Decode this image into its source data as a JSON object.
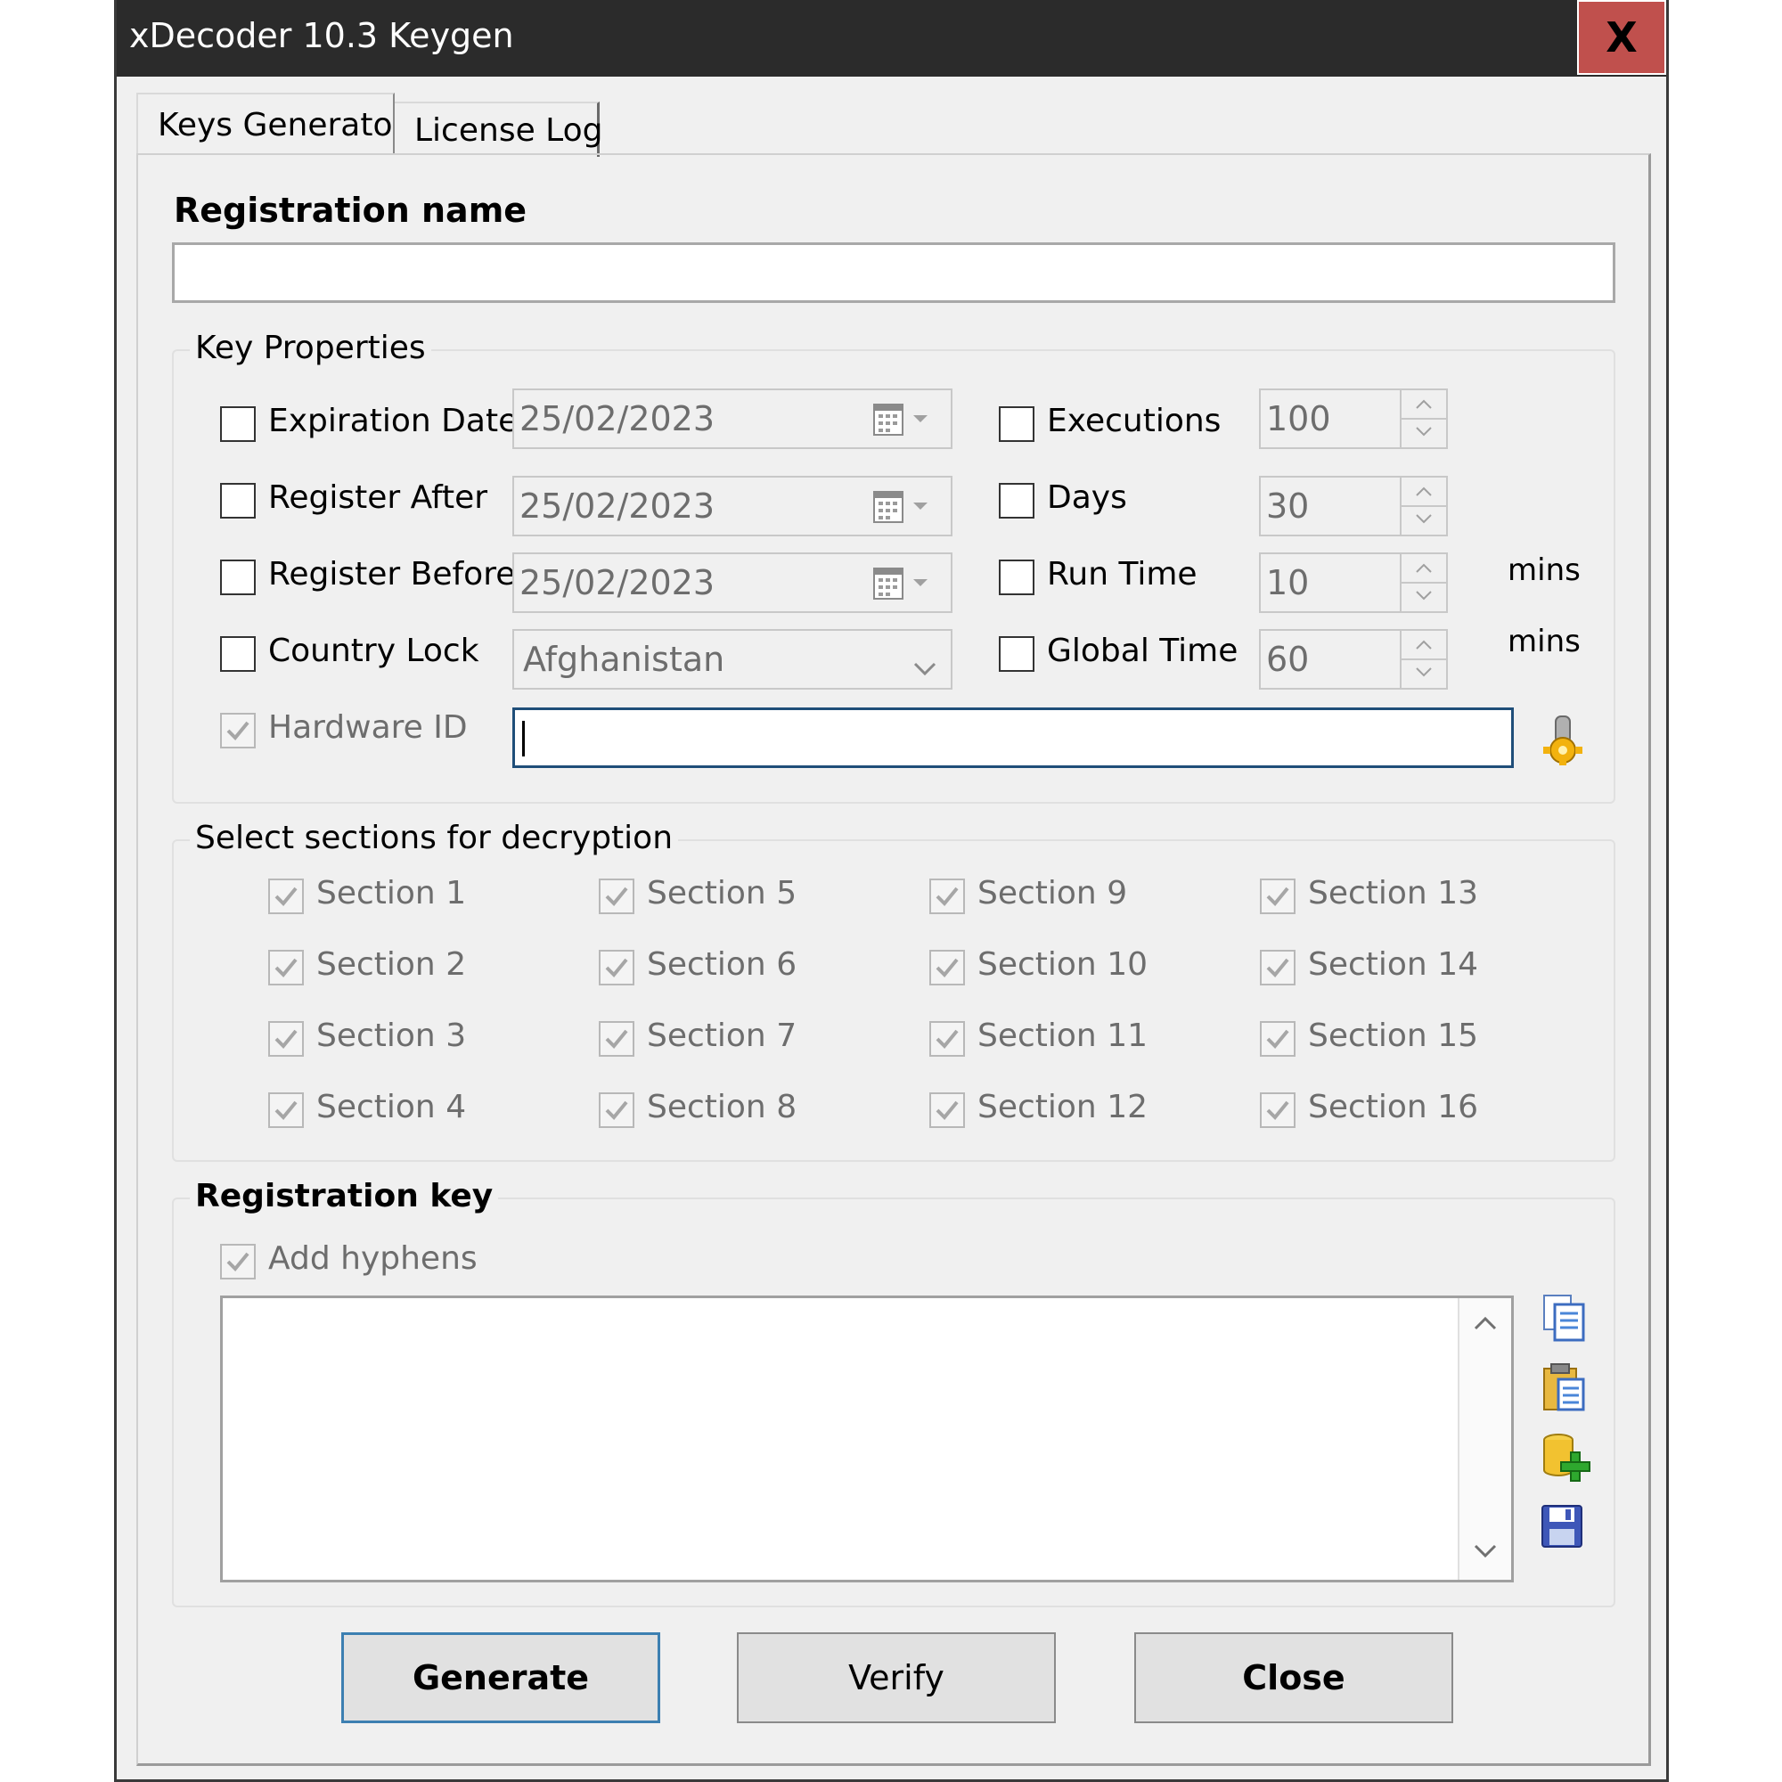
{
  "window": {
    "title": "xDecoder 10.3 Keygen",
    "close_label": "X"
  },
  "tabs": [
    {
      "label": "Keys Generator"
    },
    {
      "label": "License Log"
    }
  ],
  "registration_name": {
    "label": "Registration name",
    "value": ""
  },
  "key_properties": {
    "title": "Key Properties",
    "expiration_date": {
      "label": "Expiration Date",
      "value": "25/02/2023"
    },
    "register_after": {
      "label": "Register After",
      "value": "25/02/2023"
    },
    "register_before": {
      "label": "Register Before",
      "value": "25/02/2023"
    },
    "country_lock": {
      "label": "Country Lock",
      "value": "Afghanistan"
    },
    "hardware_id": {
      "label": "Hardware ID",
      "value": ""
    },
    "executions": {
      "label": "Executions",
      "value": "100"
    },
    "days": {
      "label": "Days",
      "value": "30"
    },
    "run_time": {
      "label": "Run Time",
      "value": "10",
      "unit": "mins"
    },
    "global_time": {
      "label": "Global Time",
      "value": "60",
      "unit": "mins"
    }
  },
  "sections": {
    "title": "Select sections for decryption",
    "items": [
      "Section 1",
      "Section 2",
      "Section 3",
      "Section 4",
      "Section 5",
      "Section 6",
      "Section 7",
      "Section 8",
      "Section 9",
      "Section 10",
      "Section 11",
      "Section 12",
      "Section 13",
      "Section 14",
      "Section 15",
      "Section 16"
    ]
  },
  "registration_key": {
    "title": "Registration key",
    "add_hyphens_label": "Add hyphens",
    "value": ""
  },
  "buttons": {
    "generate": "Generate",
    "verify": "Verify",
    "close": "Close"
  },
  "colors": {
    "titlebar": "#2b2b2b",
    "close_button": "#c0504d",
    "window_bg": "#f0f0f0",
    "focus_border": "#1f4e79",
    "generate_border": "#3c7fb1"
  }
}
